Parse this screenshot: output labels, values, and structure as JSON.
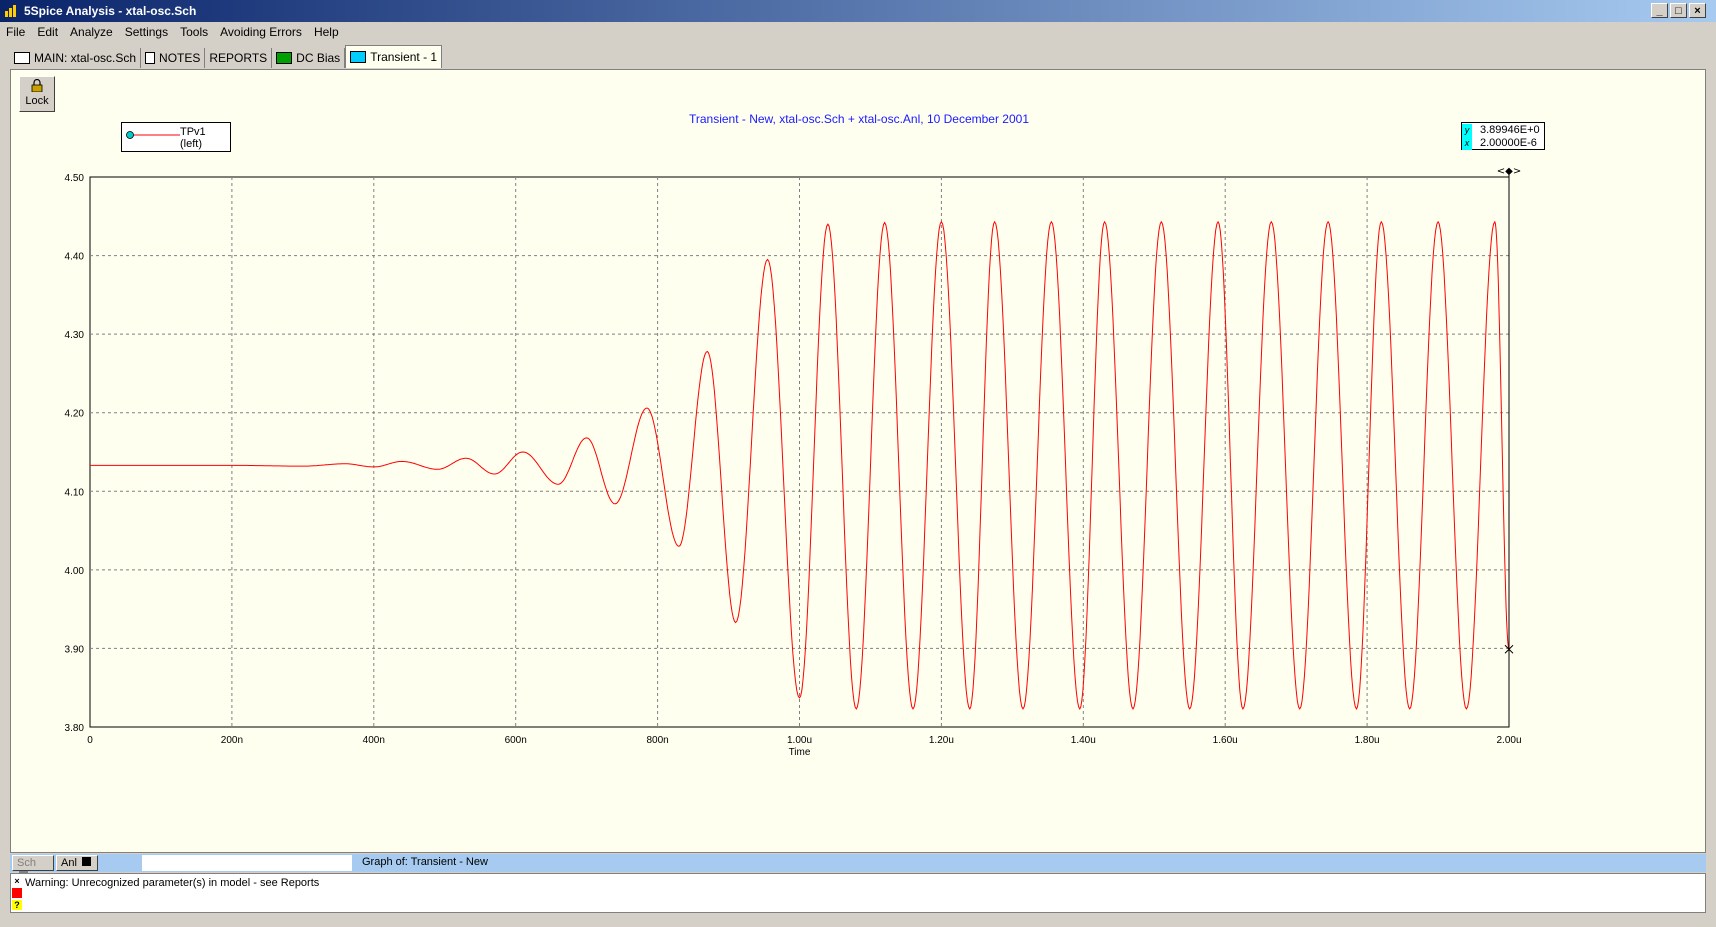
{
  "window": {
    "title": "5Spice Analysis - xtal-osc.Sch",
    "buttons": [
      "_",
      "□",
      "×"
    ]
  },
  "menu": [
    "File",
    "Edit",
    "Analyze",
    "Settings",
    "Tools",
    "Avoiding Errors",
    "Help"
  ],
  "tabs": [
    {
      "label": "MAIN:  xtal-osc.Sch",
      "icon": "schematic-icon"
    },
    {
      "label": "NOTES",
      "icon": "notes-icon"
    },
    {
      "label": "REPORTS",
      "icon": ""
    },
    {
      "label": "DC Bias",
      "icon": "dc-bias-icon"
    },
    {
      "label": "Transient - 1",
      "icon": "transient-icon"
    }
  ],
  "lock_label": "Lock",
  "graph_title": "Transient - New,    xtal-osc.Sch + xtal-osc.Anl,   10 December 2001",
  "legend": {
    "series_label": "TPv1 (left)"
  },
  "readout": {
    "y_label": "y",
    "y_value": "3.89946E+0",
    "x_label": "x",
    "x_value": "2.00000E-6"
  },
  "cursor_marker": "<◆>",
  "status": {
    "sch_label": "Sch",
    "anl_label": "Anl",
    "graph_of": "Graph of:  Transient - New"
  },
  "message": "Warning: Unrecognized parameter(s) in model - see Reports",
  "colors": {
    "trace": "#ff0000",
    "title": "#1a1aff",
    "background": "#fffff0",
    "grid": "#808080"
  },
  "chart_data": {
    "type": "line",
    "xlabel": "Time",
    "ylabel": "",
    "xlim": [
      0,
      2e-06
    ],
    "ylim": [
      3.8,
      4.5
    ],
    "x_ticks": [
      "0",
      "200n",
      "400n",
      "600n",
      "800n",
      "1.00u",
      "1.20u",
      "1.40u",
      "1.60u",
      "1.60u",
      "1.80u",
      "2.00u"
    ],
    "x_tick_labels": [
      "0",
      "200n",
      "400n",
      "600n",
      "800n",
      "1.00u",
      "1.20u",
      "1.40u",
      "1.60u",
      "1.80u",
      "2.00u"
    ],
    "y_tick_labels": [
      "4.50",
      "4.40",
      "4.30",
      "4.20",
      "4.10",
      "4.00",
      "3.90",
      "3.80"
    ],
    "grid": true,
    "legend_position": "top-left",
    "series": [
      {
        "name": "TPv1 (left)",
        "description_points": {
          "x": [
            0,
            2e-07,
            3e-07,
            3.6e-07,
            4e-07,
            4.4e-07,
            4.9e-07,
            5.3e-07,
            5.7e-07,
            6.1e-07,
            6.6e-07,
            7e-07,
            7.4e-07,
            7.85e-07,
            8.3e-07,
            8.7e-07,
            9.1e-07,
            9.55e-07,
            1e-06,
            1.04e-06,
            1.08e-06,
            1.12e-06,
            1.16e-06,
            1.2e-06,
            1.24e-06,
            1.275e-06,
            1.315e-06,
            1.355e-06,
            1.395e-06,
            1.43e-06,
            1.47e-06,
            1.51e-06,
            1.55e-06,
            1.59e-06,
            1.625e-06,
            1.665e-06,
            1.705e-06,
            1.745e-06,
            1.785e-06,
            1.82e-06,
            1.86e-06,
            1.9e-06,
            1.94e-06,
            1.98e-06,
            2e-06
          ],
          "y": [
            4.133,
            4.133,
            4.132,
            4.135,
            4.131,
            4.138,
            4.128,
            4.142,
            4.122,
            4.15,
            4.109,
            4.168,
            4.084,
            4.206,
            4.03,
            4.278,
            3.933,
            4.395,
            3.837,
            4.44,
            3.823,
            4.442,
            3.823,
            4.443,
            3.823,
            4.443,
            3.823,
            4.443,
            3.823,
            4.443,
            3.823,
            4.443,
            3.823,
            4.443,
            3.823,
            4.443,
            3.823,
            4.443,
            3.823,
            4.443,
            3.823,
            4.443,
            3.823,
            4.443,
            3.899
          ]
        }
      }
    ]
  }
}
